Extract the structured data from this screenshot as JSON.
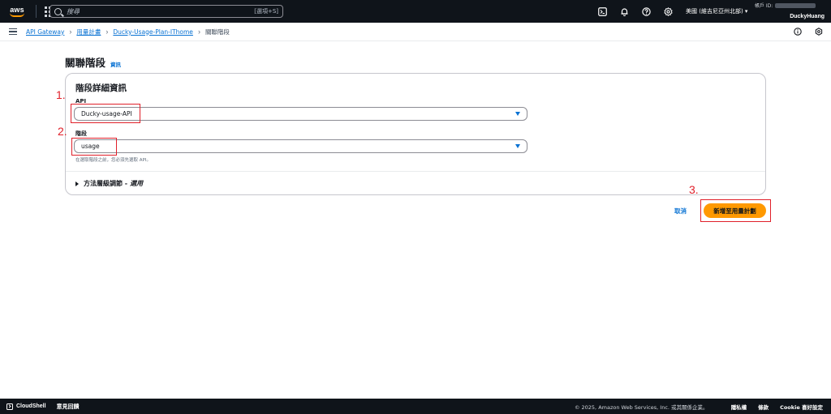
{
  "topnav": {
    "logo": "aws",
    "search_placeholder": "搜尋",
    "search_shortcut": "[選項+S]",
    "region": "美國 (維吉尼亞州北部) ▾",
    "account_label": "帳戶 ID:",
    "username": "DuckyHuang",
    "icons": [
      "cloudshell-icon",
      "bell-icon",
      "help-icon",
      "gear-icon"
    ]
  },
  "breadcrumb": {
    "items": [
      "API Gateway",
      "用量計畫",
      "Ducky-Usage-Plan-IThome"
    ],
    "current": "關聯階段"
  },
  "page": {
    "title": "關聯階段",
    "info": "資訊"
  },
  "card": {
    "title": "階段詳細資訊",
    "api_label": "API",
    "api_value": "Ducky-usage-API",
    "stage_label": "階段",
    "stage_value": "usage",
    "hint": "在選取階段之前，您必須先選取 API。",
    "expander_label": "方法層級調節 -",
    "expander_optional": "選用"
  },
  "actions": {
    "cancel": "取消",
    "submit": "新增至用量計劃"
  },
  "annotations": {
    "n1": "1.",
    "n2": "2.",
    "n3": "3.",
    "color": "#e0202a"
  },
  "footer": {
    "cloudshell": "CloudShell",
    "feedback": "意見回饋",
    "copyright": "© 2025, Amazon Web Services, Inc. 或其關係企業。",
    "privacy": "隱私權",
    "terms": "條款",
    "cookie": "Cookie 喜好設定"
  },
  "colors": {
    "nav_bg": "#0f141a",
    "link": "#0972d3",
    "primary": "#ff9900"
  }
}
